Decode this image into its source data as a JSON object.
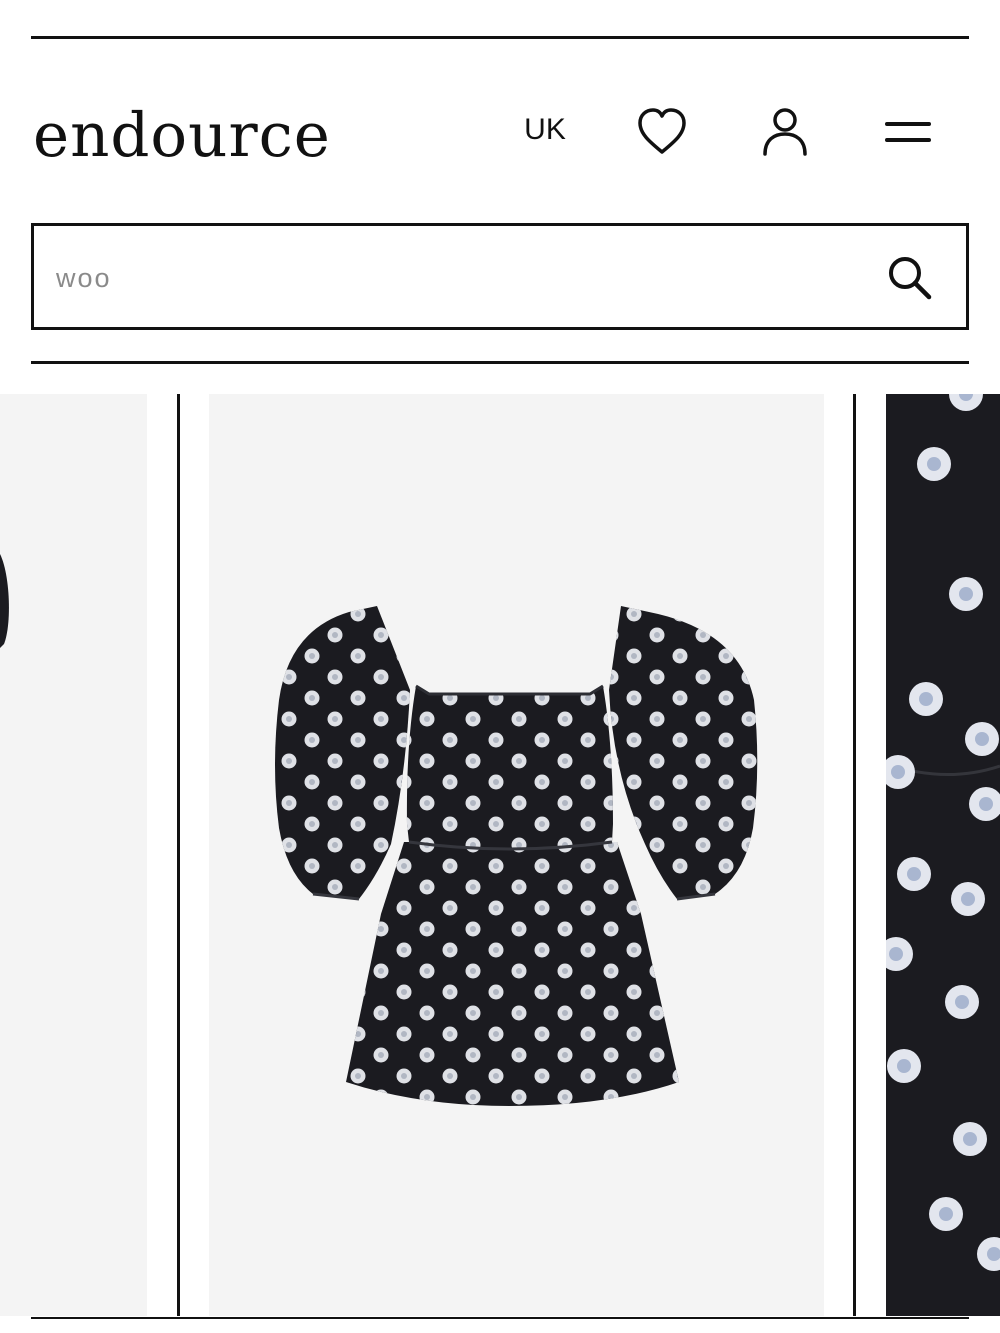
{
  "header": {
    "logo": "endource",
    "region": "UK",
    "icons": {
      "wishlist": "heart-icon",
      "account": "user-icon",
      "menu": "menu-icon"
    }
  },
  "search": {
    "value": "woo",
    "icon": "search-icon"
  },
  "gallery": {
    "product_image": "product-image",
    "colors": {
      "background": "#f4f4f4",
      "fabric": "#1b1b20",
      "print": "#e9ebf0"
    }
  }
}
